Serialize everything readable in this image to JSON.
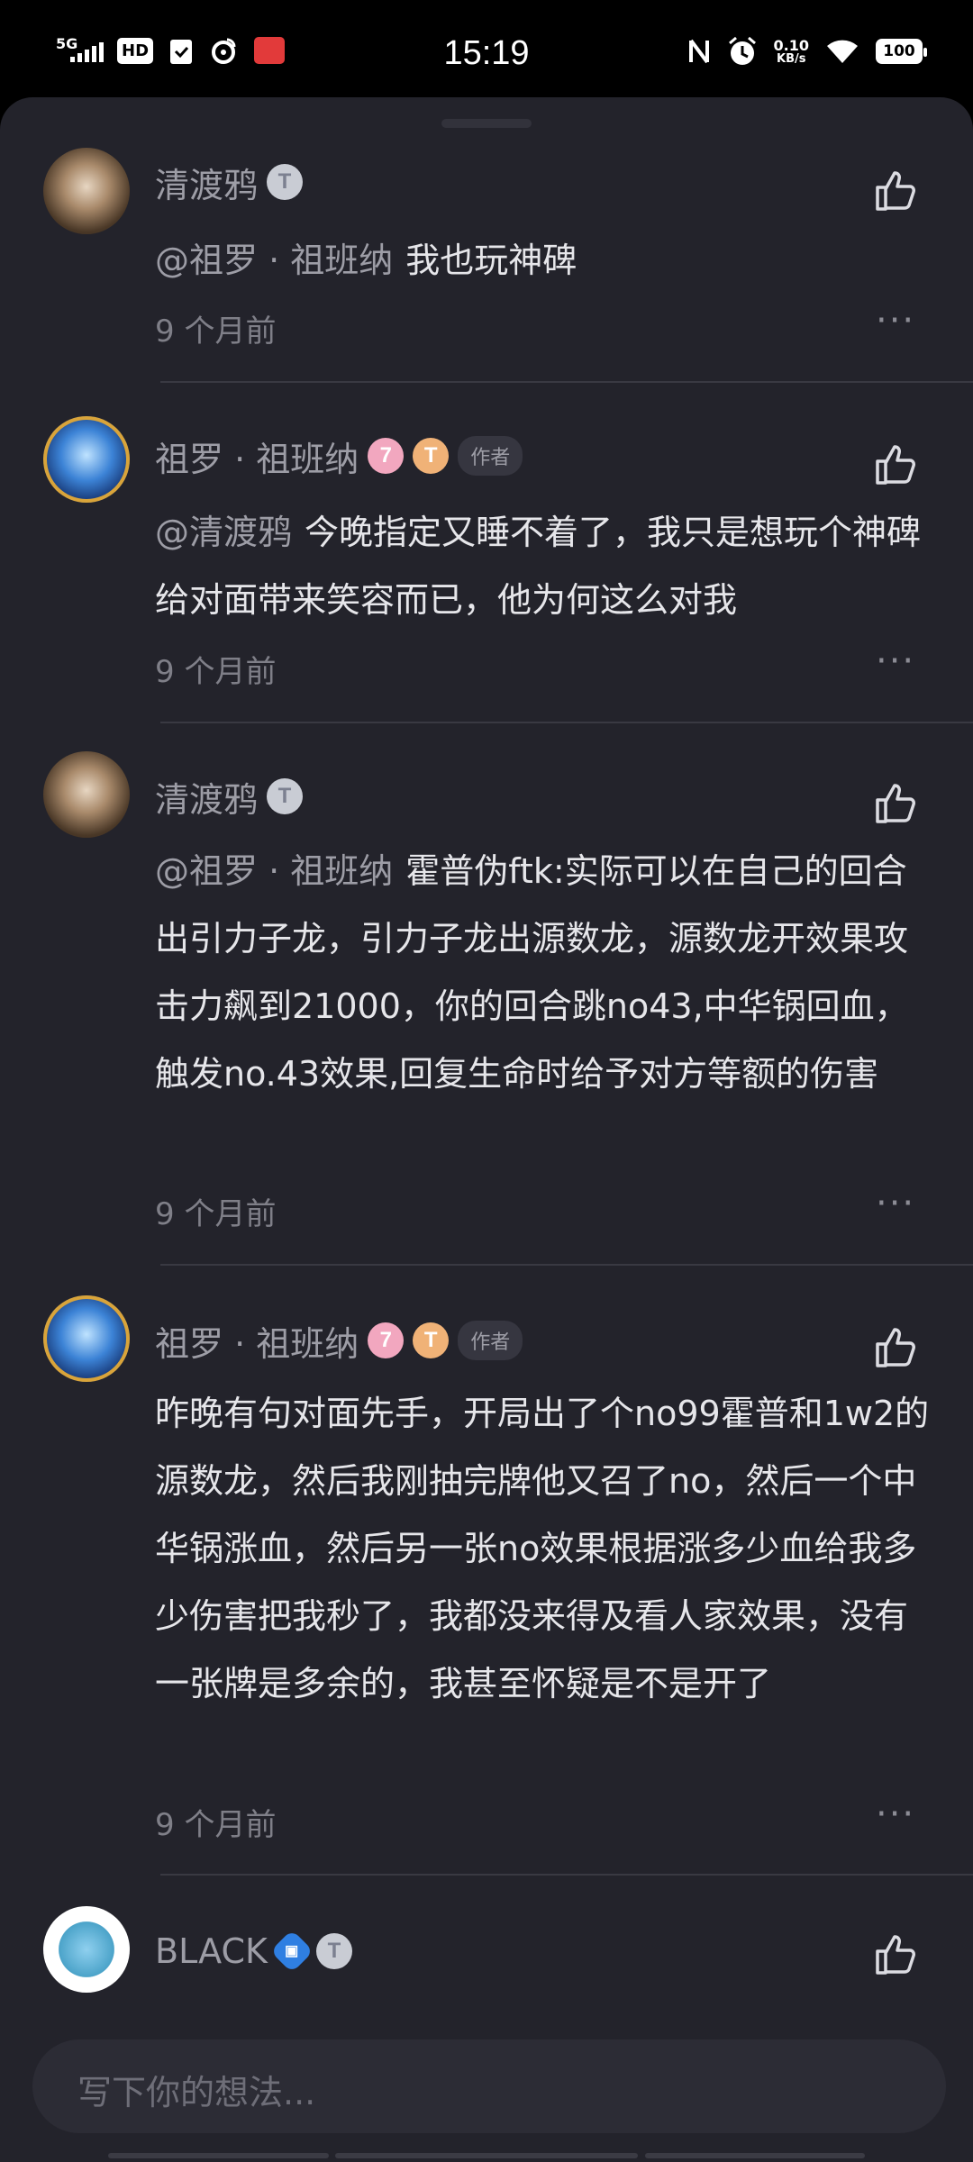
{
  "status_bar": {
    "time": "15:19",
    "network": "5G",
    "hd": "HD",
    "speed_value": "0.10",
    "speed_unit": "KB/s",
    "battery": "100"
  },
  "comments": [
    {
      "username": "清渡鸦",
      "mention": "@祖罗 · 祖班纳",
      "text": "我也玩神碑",
      "time": "9 个月前",
      "avatar": "crow-avatar"
    },
    {
      "username": "祖罗 · 祖班纳",
      "badge1": "7",
      "badge2": "T",
      "author_tag": "作者",
      "mention": "@清渡鸦",
      "text": "今晚指定又睡不着了，我只是想玩个神碑给对面带来笑容而已，他为何这么对我",
      "time": "9 个月前",
      "avatar": "blue-avatar"
    },
    {
      "username": "清渡鸦",
      "mention": "@祖罗 · 祖班纳",
      "text": "霍普伪ftk:实际可以在自己的回合出引力子龙，引力子龙出源数龙，源数龙开效果攻击力飙到21000，你的回合跳no43,中华锅回血，触发no.43效果,回复生命时给予对方等额的伤害",
      "time": "9 个月前",
      "avatar": "crow-avatar"
    },
    {
      "username": "祖罗 · 祖班纳",
      "badge1": "7",
      "badge2": "T",
      "author_tag": "作者",
      "mention": "",
      "text": "昨晚有句对面先手，开局出了个no99霍普和1w2的源数龙，然后我刚抽完牌他又召了no，然后一个中华锅涨血，然后另一张no效果根据涨多少血给我多少伤害把我秒了，我都没来得及看人家效果，没有一张牌是多余的，我甚至怀疑是不是开了",
      "time": "9 个月前",
      "avatar": "blue-avatar"
    },
    {
      "username": "BLACK",
      "avatar": "black-avatar"
    }
  ],
  "badge_t": "T",
  "more_glyph": "···",
  "input": {
    "placeholder": "写下你的想法..."
  }
}
